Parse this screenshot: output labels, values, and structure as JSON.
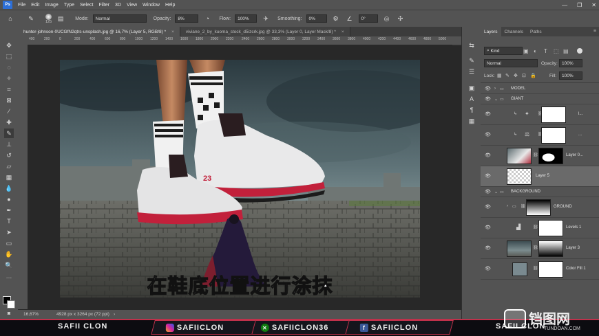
{
  "menu": {
    "app_icon": "Ps",
    "items": [
      "File",
      "Edit",
      "Image",
      "Type",
      "Select",
      "Filter",
      "3D",
      "View",
      "Window",
      "Help"
    ],
    "window_controls": [
      "—",
      "❐",
      "✕"
    ]
  },
  "options": {
    "brush_size": "125",
    "mode_label": "Mode:",
    "mode_value": "Normal",
    "opacity_label": "Opacity:",
    "opacity_value": "8%",
    "flow_label": "Flow:",
    "flow_value": "100%",
    "smoothing_label": "Smoothing:",
    "smoothing_value": "0%",
    "angle_value": "0°"
  },
  "tabs": [
    {
      "label": "hunter-johnson-0UCGfN2qtrs-unsplash.jpg @ 16,7% (Layer 5, RGB/8) *",
      "close": "×"
    },
    {
      "label": "viviane_2_by_kuoma_stock_d5izcrk.jpg @ 33,3% (Layer 0, Layer Mask/8) *",
      "close": "×"
    }
  ],
  "ruler_marks": [
    "400",
    "200",
    "0",
    "200",
    "400",
    "600",
    "800",
    "1000",
    "1200",
    "1400",
    "1600",
    "1800",
    "2000",
    "2200",
    "2400",
    "2600",
    "2800",
    "3000",
    "3200",
    "3400",
    "3600",
    "3800",
    "4000",
    "4200",
    "4400",
    "4600",
    "4800",
    "5000"
  ],
  "canvas": {
    "subtitle": "在鞋底位置进行涂抹",
    "shoe_number": "23"
  },
  "status": {
    "zoom": "16,67%",
    "doc_size": "4928 px x 3264 px (72 ppi)"
  },
  "panel": {
    "tabs": [
      "Layers",
      "Channels",
      "Paths"
    ],
    "kind_label": "Kind",
    "blend_mode": "Normal",
    "opacity_label": "Opacity:",
    "opacity_value": "100%",
    "lock_label": "Lock:",
    "fill_label": "Fill:",
    "fill_value": "100%",
    "layers": [
      {
        "name": "MODEL"
      },
      {
        "name": "GIANT"
      },
      {
        "name": "l..."
      },
      {
        "name": "..."
      },
      {
        "name": "Layer 0..."
      },
      {
        "name": "Layer 5"
      },
      {
        "name": "BACKGROUND"
      },
      {
        "name": "GROUND"
      },
      {
        "name": "Levels 1"
      },
      {
        "name": "Layer 3"
      },
      {
        "name": "Color Fill 1"
      }
    ]
  },
  "banner": {
    "left_name": "SAFII CLON",
    "instagram": "SAFIICLON",
    "xbox": "SAFIICLON36",
    "facebook": "SAFIICLON",
    "right_name": "SAFII CLON",
    "watermark": "铛图网",
    "watermark_url": "TUNDOAN.COM"
  },
  "colors": {
    "accent": "#c0314b",
    "panel_bg": "#535353",
    "selected_layer": "#6a6a6a"
  }
}
